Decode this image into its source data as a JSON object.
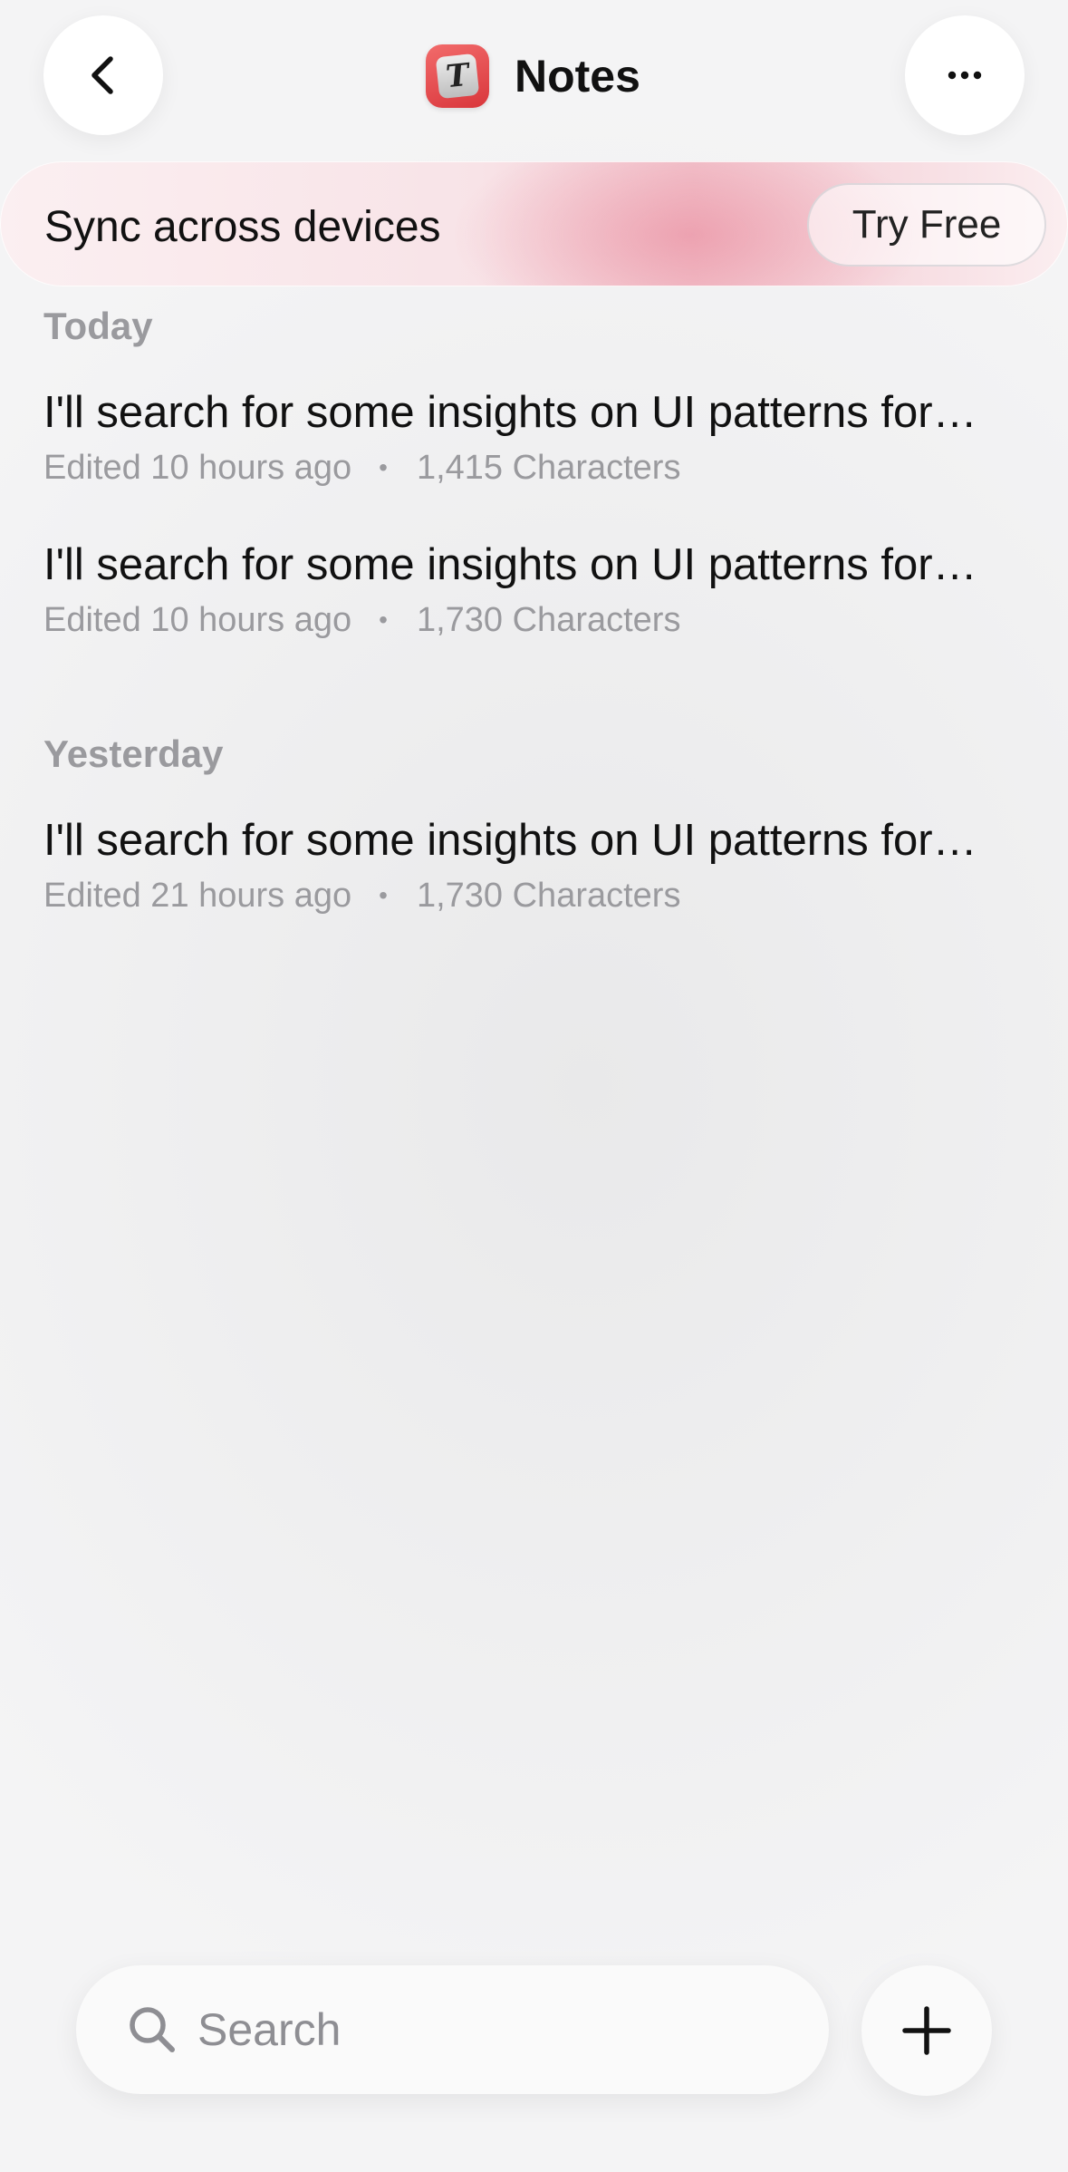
{
  "header": {
    "title": "Notes",
    "app_icon_letter": "T",
    "back_icon": "chevron-left-icon",
    "more_icon": "ellipsis-icon"
  },
  "banner": {
    "text": "Sync across devices",
    "button_label": "Try Free"
  },
  "sections": [
    {
      "label": "Today",
      "notes": [
        {
          "title": "I'll search for some insights on UI patterns for…",
          "edited": "Edited 10 hours ago",
          "separator": "•",
          "characters": "1,415 Characters"
        },
        {
          "title": "I'll search for some insights on UI patterns for…",
          "edited": "Edited 10 hours ago",
          "separator": "•",
          "characters": "1,730 Characters"
        }
      ]
    },
    {
      "label": "Yesterday",
      "notes": [
        {
          "title": "I'll search for some insights on UI patterns for…",
          "edited": "Edited 21 hours ago",
          "separator": "•",
          "characters": "1,730 Characters"
        }
      ]
    }
  ],
  "search": {
    "placeholder": "Search",
    "value": "",
    "icon": "search-icon"
  },
  "add_button": {
    "icon": "plus-icon"
  },
  "colors": {
    "accent_red": "#d9363b",
    "secondary_text": "#9a9a9e",
    "banner_pink": "#f3c9d1"
  }
}
